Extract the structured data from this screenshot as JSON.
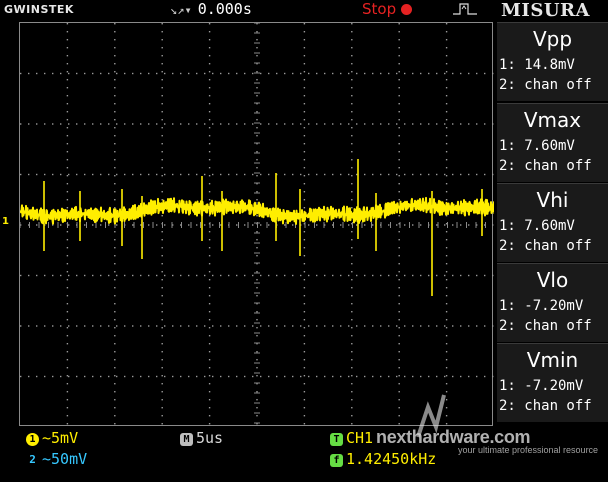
{
  "header": {
    "brand": "GWINSTEK",
    "timebase_arrows": "↘↗▾",
    "timebase_value": "0.000s",
    "run_state": "Stop",
    "run_color": "#e52222"
  },
  "trace": {
    "color": "#ffee00",
    "channel_marker": "1"
  },
  "panel": {
    "title": "MISURA",
    "measurements": [
      {
        "name": "Vpp",
        "ch1": "1: 14.8mV",
        "ch2": "2: chan off"
      },
      {
        "name": "Vmax",
        "ch1": "1: 7.60mV",
        "ch2": "2: chan off"
      },
      {
        "name": "Vhi",
        "ch1": "1: 7.60mV",
        "ch2": "2: chan off"
      },
      {
        "name": "Vlo",
        "ch1": "1: -7.20mV",
        "ch2": "2: chan off"
      },
      {
        "name": "Vmin",
        "ch1": "1: -7.20mV",
        "ch2": "2: chan off"
      }
    ]
  },
  "status": {
    "ch1_badge": "1",
    "ch1_scale": "~5mV",
    "ch1_color": "#ffee00",
    "ch2_badge": "2",
    "ch2_scale": "~50mV",
    "ch2_color": "#36c8ff",
    "horiz_badge": "M",
    "horiz_scale": "5us",
    "trig_badge": "T",
    "trig_source": "CH1",
    "freq_badge": "f",
    "freq_value": "1.42450kHz"
  },
  "watermark": {
    "site": "nexthardware.com",
    "tagline": "your ultimate professional resource"
  }
}
